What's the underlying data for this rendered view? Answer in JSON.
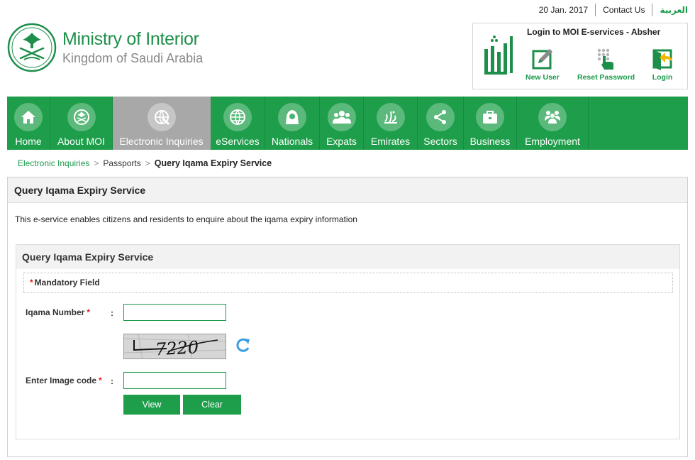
{
  "topbar": {
    "date": "20 Jan. 2017",
    "contact": "Contact Us",
    "language": "العربية"
  },
  "header": {
    "title": "Ministry of Interior",
    "subtitle": "Kingdom of Saudi Arabia"
  },
  "login": {
    "title": "Login to MOI E-services - Absher",
    "items": [
      {
        "label": "New User",
        "icon": "new-user-icon"
      },
      {
        "label": "Reset Password",
        "icon": "reset-password-icon"
      },
      {
        "label": "Login",
        "icon": "login-icon"
      }
    ]
  },
  "nav": {
    "items": [
      {
        "label": "Home",
        "icon": "home-icon"
      },
      {
        "label": "About MOI",
        "icon": "emblem-icon"
      },
      {
        "label": "Electronic Inquiries",
        "icon": "inquiries-icon",
        "active": true
      },
      {
        "label": "eServices",
        "icon": "globe-icon"
      },
      {
        "label": "Nationals",
        "icon": "nationals-icon"
      },
      {
        "label": "Expats",
        "icon": "expats-icon"
      },
      {
        "label": "Emirates",
        "icon": "emirates-icon"
      },
      {
        "label": "Sectors",
        "icon": "sectors-icon"
      },
      {
        "label": "Business",
        "icon": "briefcase-icon"
      },
      {
        "label": "Employment",
        "icon": "employment-icon"
      }
    ]
  },
  "breadcrumb": {
    "items": [
      "Electronic Inquiries",
      "Passports",
      "Query Iqama Expiry Service"
    ]
  },
  "panel": {
    "title": "Query Iqama Expiry Service",
    "description": "This e-service enables citizens and residents to enquire about the iqama expiry information"
  },
  "form": {
    "title": "Query Iqama Expiry Service",
    "mandatory_note": "Mandatory Field",
    "required_mark": "*",
    "colon": ":",
    "iqama_label": "Iqama Number",
    "iqama_value": "",
    "captcha_text": "7220",
    "image_code_label": "Enter Image code",
    "image_code_value": "",
    "view_button": "View",
    "clear_button": "Clear"
  },
  "colors": {
    "brand_green": "#1e9e4a",
    "active_nav": "#a8a8a8",
    "required_red": "#e21b1b"
  }
}
